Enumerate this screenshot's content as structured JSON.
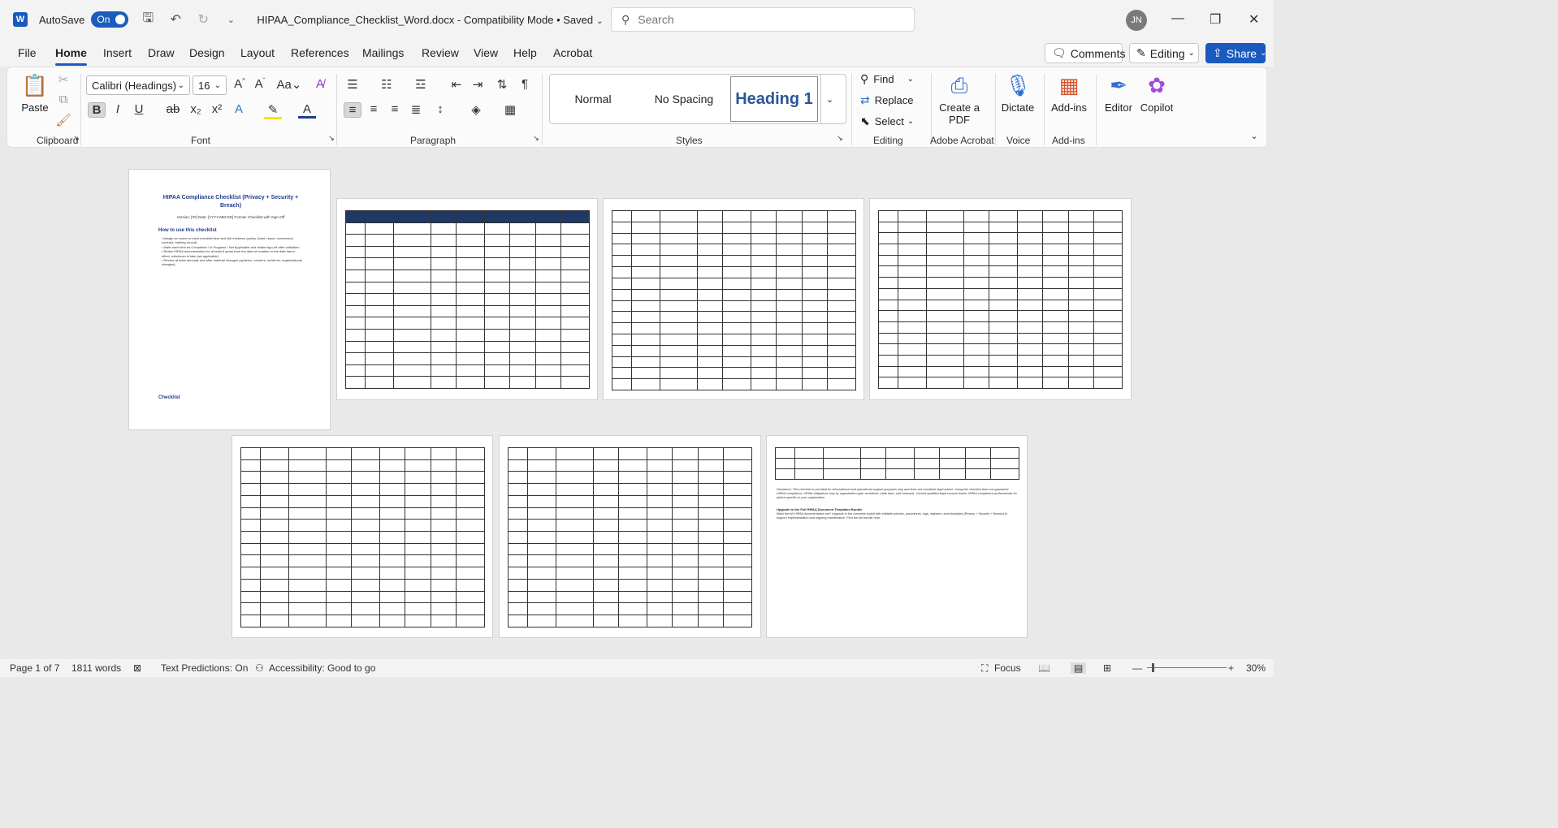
{
  "titlebar": {
    "app_icon": "W",
    "autosave_label": "AutoSave",
    "autosave_state": "On",
    "document_title": "HIPAA_Compliance_Checklist_Word.docx  -  Compatibility Mode  •  Saved",
    "search_placeholder": "Search",
    "user_initials": "JN"
  },
  "tabs": [
    "File",
    "Home",
    "Insert",
    "Draw",
    "Design",
    "Layout",
    "References",
    "Mailings",
    "Review",
    "View",
    "Help",
    "Acrobat"
  ],
  "active_tab": "Home",
  "header_buttons": {
    "comments": "Comments",
    "editing": "Editing",
    "share": "Share"
  },
  "ribbon": {
    "clipboard": {
      "label": "Clipboard",
      "paste": "Paste"
    },
    "font": {
      "label": "Font",
      "font_name": "Calibri (Headings)",
      "font_size": "16"
    },
    "paragraph": {
      "label": "Paragraph"
    },
    "styles": {
      "label": "Styles",
      "items": [
        "Normal",
        "No Spacing",
        "Heading 1"
      ]
    },
    "editing": {
      "label": "Editing",
      "find": "Find",
      "replace": "Replace",
      "select": "Select"
    },
    "adobe": {
      "label": "Adobe Acrobat",
      "create_pdf": "Create a PDF"
    },
    "voice": {
      "label": "Voice",
      "dictate": "Dictate"
    },
    "addins": {
      "label": "Add-ins",
      "addins_btn": "Add-ins",
      "editor": "Editor",
      "copilot": "Copilot"
    }
  },
  "document": {
    "page1": {
      "title": "HIPAA Compliance Checklist (Privacy + Security + Breach)",
      "meta": "Version: [##] Date: [YYYY-MM-DD] Format: Checklist with Sign-Off",
      "how_to_heading": "How to use this checklist",
      "bullets": [
        "Assign an owner to each checklist item and link evidence (policy, ticket, report, screenshot, contract, training record).",
        "Mark each item as Completed / In Progress / Not Applicable and obtain sign-off after validation.",
        "Retain HIPAA documentation for at least 6 years from the date of creation or the date last in effect, whichever is later (as applicable).",
        "Review at least annually and after material changes (systems, vendors, incidents, organizational changes)."
      ],
      "section_heading": "Checklist"
    },
    "last_page": {
      "disclaimer": "Disclaimer: This checklist is provided for informational and operational support purposes only and does not constitute legal advice. Using this checklist does not guarantee HIPAA compliance. HIPAA obligations vary by organization type, workflows, state laws, and contracts. Consult qualified legal counsel and/or HIPAA compliance professionals for advice specific to your organization.",
      "upgrade_heading": "Upgrade to the Full HIPAA Document Templates Bundle",
      "upgrade_text": "Want the full HIPAA documentation set? Upgrade to the complete toolkit with editable policies, procedures, logs, registers, and templates (Privacy + Security + Breach) to support implementation and ongoing maintenance. Find the full bundle here."
    }
  },
  "statusbar": {
    "page": "Page 1 of 7",
    "words": "1811 words",
    "text_predictions": "Text Predictions: On",
    "accessibility": "Accessibility: Good to go",
    "focus": "Focus",
    "zoom": "30%"
  }
}
